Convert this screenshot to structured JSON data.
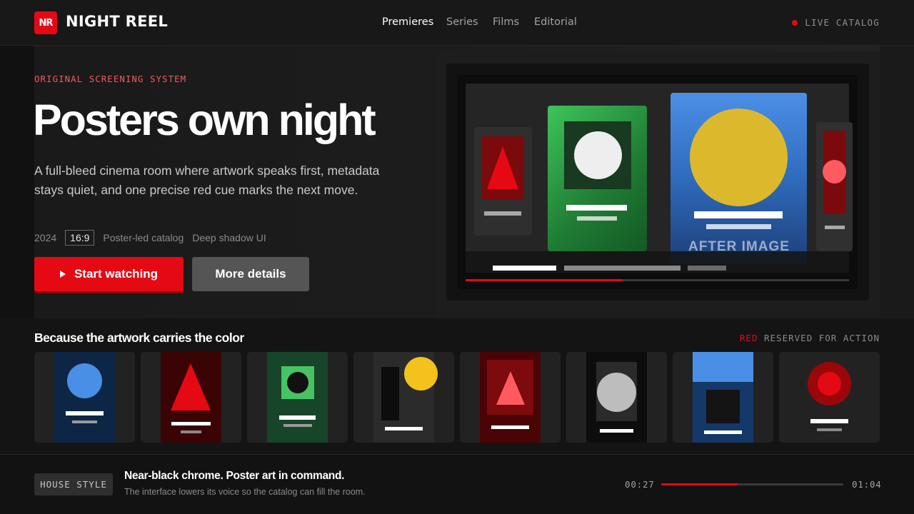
{
  "header": {
    "logo_badge": "NR",
    "brand": "NIGHT REEL",
    "nav": [
      "Premieres",
      "Series",
      "Films",
      "Editorial"
    ],
    "active_nav": "Premieres",
    "live_label": "LIVE CATALOG"
  },
  "hero": {
    "eyebrow": "ORIGINAL SCREENING SYSTEM",
    "title": "Posters own night",
    "description": "A full-bleed cinema room where artwork speaks first, metadata stays quiet, and one precise red cue marks the next move.",
    "meta": {
      "year": "2024",
      "ratio": "16:9",
      "tag1": "Poster-led catalog",
      "tag2": "Deep shadow UI"
    },
    "primary_button": "Start watching",
    "secondary_button": "More details",
    "screen_feature_text": "AFTER IMAGE",
    "screen_progress": 0.41
  },
  "row": {
    "title": "Because the artwork carries the color",
    "note_red": "RED",
    "note_rest": " RESERVED FOR ACTION",
    "cards": [
      {
        "poster": "blue-circle"
      },
      {
        "poster": "red-triangle"
      },
      {
        "poster": "green-square"
      },
      {
        "poster": "yellow-sun"
      },
      {
        "poster": "crimson-triangle"
      },
      {
        "poster": "grey-circle"
      },
      {
        "poster": "blue-block"
      },
      {
        "poster": "red-ring"
      }
    ]
  },
  "footer": {
    "chip": "HOUSE STYLE",
    "title": "Near-black chrome. Poster art in command.",
    "subtitle": "The interface lowers its voice so the catalog can fill the room.",
    "time_current": "00:27",
    "time_total": "01:04",
    "progress": 0.42
  },
  "colors": {
    "accent": "#e50914",
    "background": "#141414",
    "eyebrow": "#f05a5f"
  }
}
